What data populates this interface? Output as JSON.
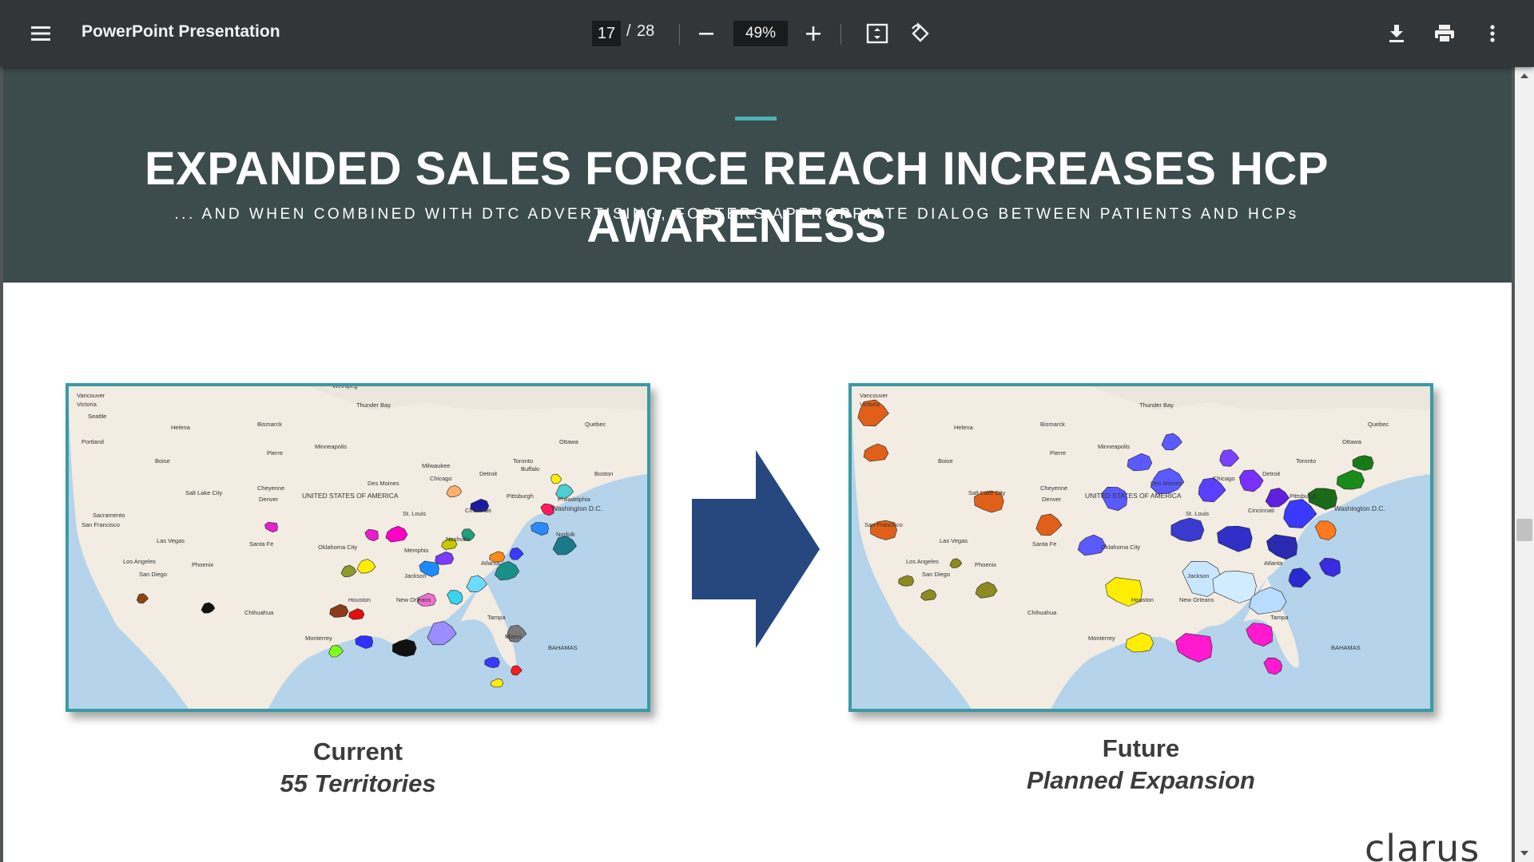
{
  "toolbar": {
    "document_title": "PowerPoint Presentation",
    "current_page": "17",
    "page_separator": "/",
    "total_pages": "28",
    "zoom": "49%",
    "icons": [
      "menu-icon",
      "zoom-out-icon",
      "zoom-in-icon",
      "fit-page-icon",
      "rotate-icon",
      "download-icon",
      "print-icon",
      "more-options-icon"
    ]
  },
  "slide": {
    "title": "EXPANDED SALES FORCE REACH INCREASES HCP AWARENESS",
    "subtitle": "... AND WHEN COMBINED WITH DTC ADVERTISING, FOSTERS APPROPRIATE DIALOG BETWEEN PATIENTS AND HCPs",
    "accent_color": "#4bb1b4",
    "header_color": "#3c4b4c",
    "arrow_color": "#27477f",
    "left_panel": {
      "heading": "Current",
      "subheading": "55 Territories",
      "map_labels": [
        "Vancouver",
        "Victoria",
        "Seattle",
        "Portland",
        "Helena",
        "Bismarck",
        "Pierre",
        "Minneapolis",
        "Thunder Bay",
        "Quebec",
        "Ottawa",
        "Toronto",
        "Boston",
        "Detroit",
        "Chicago",
        "Milwaukee",
        "Buffalo",
        "Pittsburgh",
        "Philadelphia",
        "Washington D.C.",
        "Cincinnati",
        "St. Louis",
        "Nashville",
        "Memphis",
        "Atlanta",
        "Jackson",
        "Houston",
        "New Orleans",
        "Tampa",
        "Miami",
        "Oklahoma City",
        "Des Moines",
        "Denver",
        "Cheyenne",
        "Salt Lake City",
        "Boise",
        "Sacramento",
        "San Francisco",
        "Las Vegas",
        "Los Angeles",
        "San Diego",
        "Phoenix",
        "Santa Fe",
        "Chihuahua",
        "Monterrey",
        "Norfolk",
        "Winnipeg",
        "UNITED STATES OF AMERICA",
        "BAHAMAS"
      ]
    },
    "right_panel": {
      "heading": "Future",
      "subheading": "Planned Expansion",
      "map_labels": [
        "Vancouver",
        "Victoria",
        "Helena",
        "Bismarck",
        "Pierre",
        "Minneapolis",
        "Thunder Bay",
        "Quebec",
        "Ottawa",
        "Toronto",
        "Detroit",
        "Chicago",
        "Pittsburgh",
        "Washington D.C.",
        "Cincinnati",
        "St. Louis",
        "Atlanta",
        "Jackson",
        "Houston",
        "New Orleans",
        "Tampa",
        "Oklahoma City",
        "Des Moines",
        "Denver",
        "Cheyenne",
        "Salt Lake City",
        "Boise",
        "San Francisco",
        "Las Vegas",
        "Los Angeles",
        "San Diego",
        "Phoenix",
        "Santa Fe",
        "Chihuahua",
        "Monterrey",
        "UNITED STATES OF AMERICA",
        "BAHAMAS"
      ]
    },
    "brand": "clarus"
  }
}
